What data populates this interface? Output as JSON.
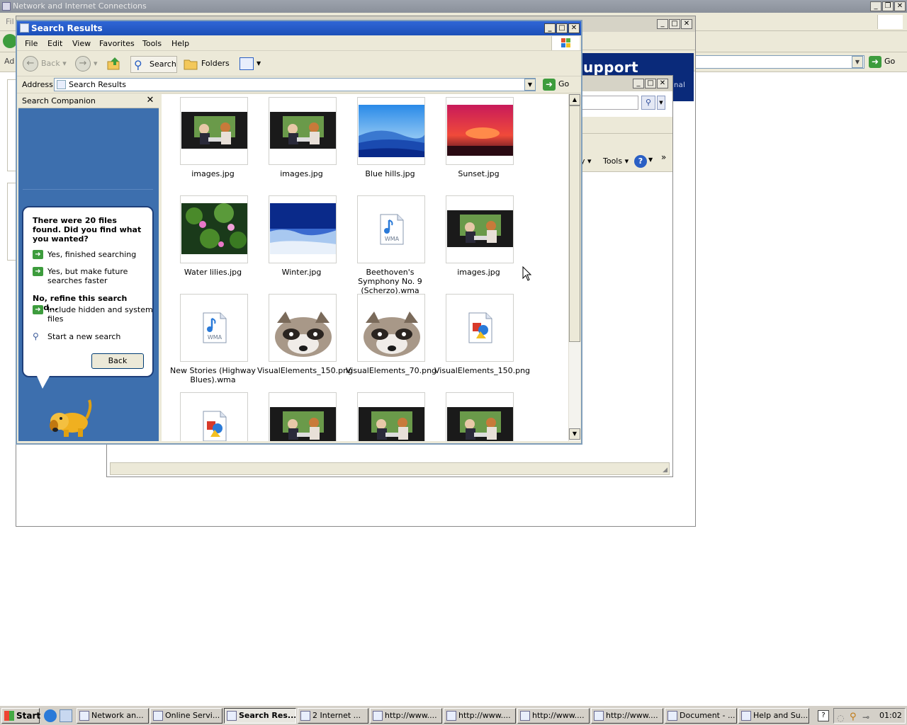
{
  "background_window": {
    "title": "Network and Internet Connections",
    "menu_first": "Fil",
    "address_label": "Ad"
  },
  "help_window": {
    "header_text": "upport Center",
    "header_sub": "nal",
    "go_label": "Go"
  },
  "online_window": {
    "toolbar_partial": "y",
    "tools_label": "Tools",
    "help_icon": "help-icon"
  },
  "search_window": {
    "title": "Search Results",
    "menu": [
      "File",
      "Edit",
      "View",
      "Favorites",
      "Tools",
      "Help"
    ],
    "toolbar": {
      "back": "Back",
      "search": "Search",
      "folders": "Folders"
    },
    "address": {
      "label": "Address",
      "value": "Search Results",
      "go": "Go"
    },
    "companion": {
      "title": "Search Companion",
      "question": "There were 20 files found. Did you find what you wanted?",
      "opt_yes_finished": "Yes, finished searching",
      "opt_yes_faster": "Yes, but make future searches faster",
      "refine_heading": "No, refine this search and...",
      "opt_hidden": "Include hidden and system files",
      "opt_new": "Start a new search",
      "back_button": "Back"
    },
    "files": [
      {
        "name": "images.jpg",
        "kind": "scene"
      },
      {
        "name": "images.jpg",
        "kind": "scene"
      },
      {
        "name": "Blue hills.jpg",
        "kind": "hills"
      },
      {
        "name": "Sunset.jpg",
        "kind": "sunset"
      },
      {
        "name": "Water lilies.jpg",
        "kind": "lilies"
      },
      {
        "name": "Winter.jpg",
        "kind": "winter"
      },
      {
        "name": "Beethoven's Symphony No. 9 (Scherzo).wma",
        "kind": "wma"
      },
      {
        "name": "images.jpg",
        "kind": "scene"
      },
      {
        "name": "New Stories (Highway Blues).wma",
        "kind": "wma"
      },
      {
        "name": "VisualElements_150.png",
        "kind": "raccoon"
      },
      {
        "name": "VisualElements_70.png",
        "kind": "raccoon"
      },
      {
        "name": "VisualElements_150.png",
        "kind": "png"
      },
      {
        "name": "",
        "kind": "png"
      },
      {
        "name": "",
        "kind": "scene"
      },
      {
        "name": "",
        "kind": "scene"
      },
      {
        "name": "",
        "kind": "scene"
      }
    ],
    "wma_badge": "WMA"
  },
  "taskbar": {
    "start": "Start",
    "tasks": [
      {
        "label": "Network an...",
        "active": false
      },
      {
        "label": "Online Servi...",
        "active": false
      },
      {
        "label": "Search Res...",
        "active": true
      },
      {
        "label": "2 Internet ...",
        "active": false
      },
      {
        "label": "http://www....",
        "active": false
      },
      {
        "label": "http://www....",
        "active": false
      },
      {
        "label": "http://www....",
        "active": false
      },
      {
        "label": "http://www....",
        "active": false
      },
      {
        "label": "Document - ...",
        "active": false
      },
      {
        "label": "Help and Su...",
        "active": false
      }
    ],
    "clock": "01:02"
  },
  "colors": {
    "title_blue": "#2f66d6",
    "companion_blue": "#3d6fae",
    "go_green": "#3d9c3d",
    "help_navy": "#0a2a7a"
  }
}
